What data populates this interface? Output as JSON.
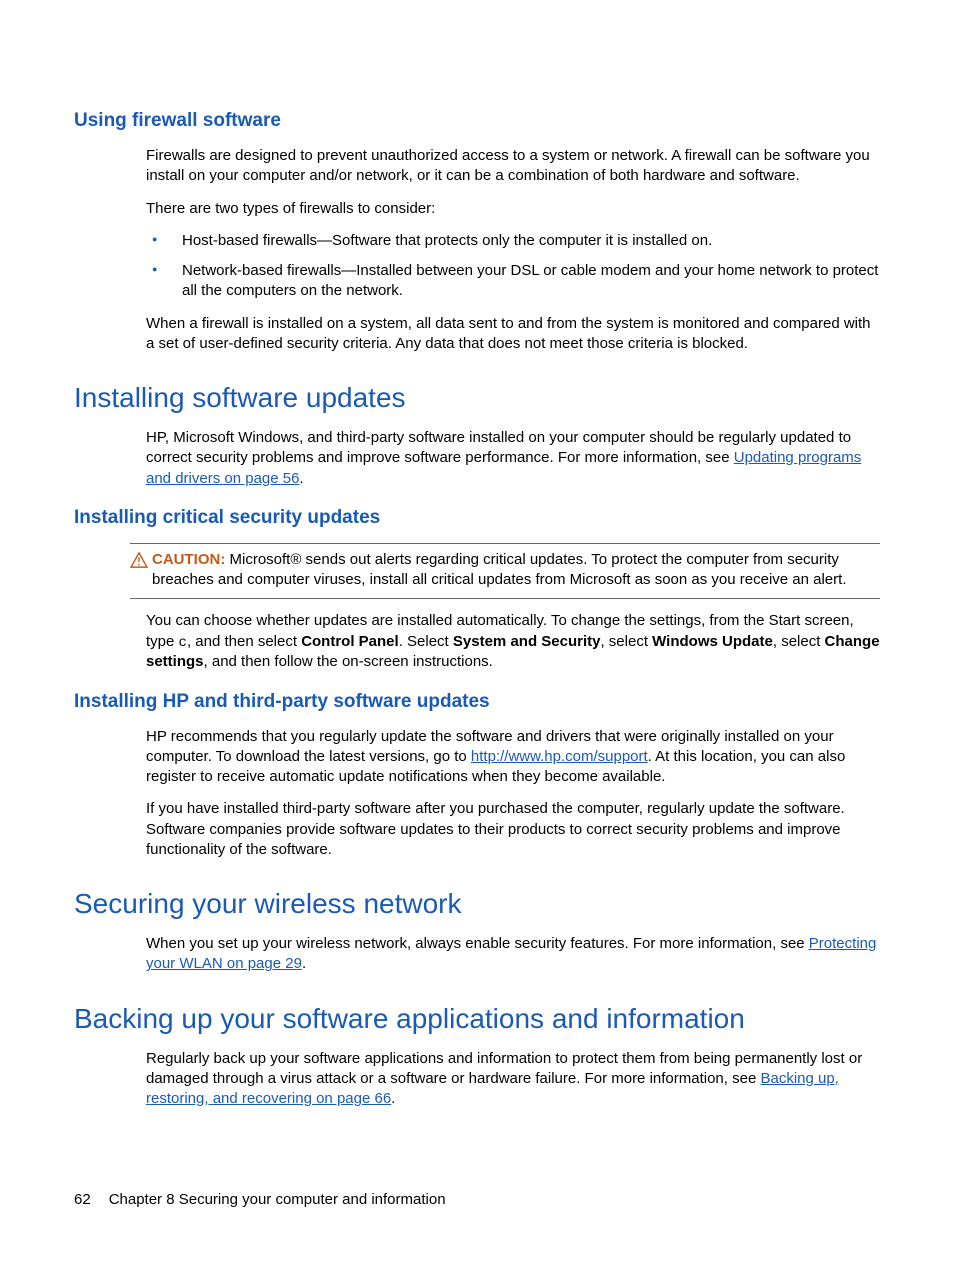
{
  "section1": {
    "heading": "Using firewall software",
    "p1": "Firewalls are designed to prevent unauthorized access to a system or network. A firewall can be software you install on your computer and/or network, or it can be a combination of both hardware and software.",
    "p2": "There are two types of firewalls to consider:",
    "bullets": [
      "Host-based firewalls—Software that protects only the computer it is installed on.",
      "Network-based firewalls—Installed between your DSL or cable modem and your home network to protect all the computers on the network."
    ],
    "p3": "When a firewall is installed on a system, all data sent to and from the system is monitored and compared with a set of user-defined security criteria. Any data that does not meet those criteria is blocked."
  },
  "section2": {
    "heading": "Installing software updates",
    "p1a": "HP, Microsoft Windows, and third-party software installed on your computer should be regularly updated to correct security problems and improve software performance. For more information, see ",
    "p1_link": "Updating programs and drivers on page 56",
    "p1b": "."
  },
  "section3": {
    "heading": "Installing critical security updates",
    "caution_label": "CAUTION:",
    "caution_text": "Microsoft® sends out alerts regarding critical updates. To protect the computer from security breaches and computer viruses, install all critical updates from Microsoft as soon as you receive an alert.",
    "p2_parts": {
      "a": "You can choose whether updates are installed automatically. To change the settings, from the Start screen, type ",
      "mono": "c",
      "b": ", and then select ",
      "bold1": "Control Panel",
      "c": ". Select ",
      "bold2": "System and Security",
      "d": ", select ",
      "bold3": "Windows Update",
      "e": ", select ",
      "bold4": "Change settings",
      "f": ", and then follow the on-screen instructions."
    }
  },
  "section4": {
    "heading": "Installing HP and third-party software updates",
    "p1a": "HP recommends that you regularly update the software and drivers that were originally installed on your computer. To download the latest versions, go to ",
    "p1_link": "http://www.hp.com/support",
    "p1b": ". At this location, you can also register to receive automatic update notifications when they become available.",
    "p2": "If you have installed third-party software after you purchased the computer, regularly update the software. Software companies provide software updates to their products to correct security problems and improve functionality of the software."
  },
  "section5": {
    "heading": "Securing your wireless network",
    "p1a": "When you set up your wireless network, always enable security features. For more information, see ",
    "p1_link": "Protecting your WLAN on page 29",
    "p1b": "."
  },
  "section6": {
    "heading": "Backing up your software applications and information",
    "p1a": "Regularly back up your software applications and information to protect them from being permanently lost or damaged through a virus attack or a software or hardware failure. For more information, see ",
    "p1_link": "Backing up, restoring, and recovering on page 66",
    "p1b": "."
  },
  "footer": {
    "page": "62",
    "chapter": "Chapter 8   Securing your computer and information"
  }
}
